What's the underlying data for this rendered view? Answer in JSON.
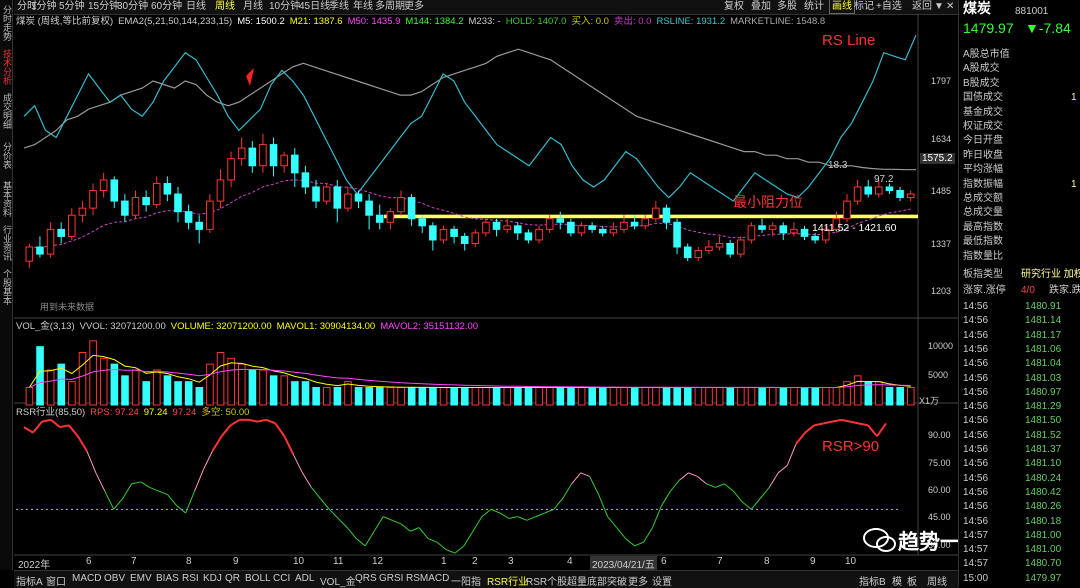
{
  "left_tabs": [
    "分时走势",
    "技术分析",
    "成交明细",
    "分价表",
    "基本资料",
    "行业资讯",
    "个股基本"
  ],
  "top_tabs": [
    "分时",
    "1分钟",
    "5分钟",
    "15分钟",
    "30分钟",
    "60分钟",
    "日线",
    "周线",
    "月线",
    "10分钟",
    "45日线",
    "季线",
    "年线",
    "多周期",
    "更多"
  ],
  "top_right": [
    "复权",
    "叠加",
    "多股",
    "统计",
    "画线",
    "标记",
    "+自选",
    "返回"
  ],
  "window_icons": [
    "▼",
    "✕"
  ],
  "legend_main": [
    {
      "text": "煤炭 (周线,等比前复权)",
      "color": "#cccccc"
    },
    {
      "text": "EMA2(5,21,50,144,233,15)",
      "color": "#cccccc"
    },
    {
      "text": "M5: 1500.2",
      "color": "#ffffff"
    },
    {
      "text": "M21: 1387.6",
      "color": "#ffff00"
    },
    {
      "text": "M50: 1435.9",
      "color": "#ff44ff"
    },
    {
      "text": "M144: 1384.2",
      "color": "#33ff33"
    },
    {
      "text": "M233: -",
      "color": "#cccccc"
    },
    {
      "text": "HOLD: 1407.0",
      "color": "#33cc33"
    },
    {
      "text": "买入: 0.0",
      "color": "#cccc00"
    },
    {
      "text": "卖出: 0.0",
      "color": "#cc33cc"
    },
    {
      "text": "RSLINE: 1931.2",
      "color": "#33cccc"
    },
    {
      "text": "MARKETLINE: 1548.8",
      "color": "#aaaaaa"
    }
  ],
  "legend_vol": [
    {
      "text": "VOL_金(3,13)",
      "color": "#cccccc"
    },
    {
      "text": "VVOL: 32071200.00",
      "color": "#cccccc"
    },
    {
      "text": "VOLUME: 32071200.00",
      "color": "#ffff00"
    },
    {
      "text": "MAVOL1: 30904134.00",
      "color": "#ffff00"
    },
    {
      "text": "MAVOL2: 35151132.00",
      "color": "#ff44ff"
    }
  ],
  "legend_rsr": [
    {
      "text": "RSR行业(85,50)",
      "color": "#cccccc"
    },
    {
      "text": "RPS: 97.24",
      "color": "#ff4444"
    },
    {
      "text": "97.24",
      "color": "#ffff00"
    },
    {
      "text": "97.24",
      "color": "#ff4444"
    },
    {
      "text": "多空: 50.00",
      "color": "#cccc00"
    }
  ],
  "annotations": {
    "rs_line": "RS Line",
    "resist": "最小阻力位",
    "resist_range": "1411.52 - 1421.60",
    "high_lbl": "18.3",
    "last_lbl": "97.2",
    "rsr90": "RSR>90",
    "no_data": "用到未来数据",
    "price_tag": "1575.2",
    "x1w": "X1万"
  },
  "y_main": [
    "1797",
    "1634",
    "1485",
    "1337",
    "1203"
  ],
  "y_vol": [
    "10000",
    "5000"
  ],
  "y_rsr": [
    "90.00",
    "75.00",
    "60.00",
    "45.00",
    "30.00"
  ],
  "x_labels": [
    "2022年",
    "6",
    "7",
    "8",
    "9",
    "10",
    "11",
    "12",
    "1",
    "2",
    "3",
    "4",
    "2023/04/21/五",
    "6",
    "7",
    "8",
    "9",
    "10"
  ],
  "bottom_tabs": [
    "指标A",
    "窗口",
    "MACD",
    "OBV",
    "EMV",
    "BIAS",
    "RSI",
    "KDJ",
    "QR",
    "BOLL",
    "CCI",
    "ADL",
    "VOL_金",
    "QRS",
    "GRSI",
    "RSMACD",
    "一阳指",
    "RSR行业",
    "RSR个股",
    "超量底部突破",
    "更多",
    "设置"
  ],
  "bottom_right": [
    "指标B",
    "模",
    "板",
    "周线"
  ],
  "quote": {
    "name": "煤炭",
    "code": "881001",
    "price": "1479.97",
    "change": "▼-7.84"
  },
  "quote_fields": [
    {
      "label": "A股总市值",
      "value": ""
    },
    {
      "label": "A股成交",
      "value": ""
    },
    {
      "label": "B股成交",
      "value": ""
    },
    {
      "label": "国债成交",
      "value": "1"
    },
    {
      "label": "基金成交",
      "value": ""
    },
    {
      "label": "权证成交",
      "value": ""
    },
    {
      "label": "今日开盘",
      "value": ""
    },
    {
      "label": "昨日收盘",
      "value": ""
    },
    {
      "label": "平均涨幅",
      "value": ""
    },
    {
      "label": "指数振幅",
      "value": "1"
    },
    {
      "label": "总成交额",
      "value": ""
    },
    {
      "label": "总成交量",
      "value": ""
    },
    {
      "label": "最高指数",
      "value": ""
    },
    {
      "label": "最低指数",
      "value": ""
    },
    {
      "label": "指数量比",
      "value": ""
    }
  ],
  "sector": {
    "label": "板指类型",
    "value": "研究行业 加权"
  },
  "adv": {
    "label": "涨家.涨停",
    "value": "4/0",
    "extra": "跌家.跌"
  },
  "ticks": [
    {
      "t": "14:56",
      "p": "1480.91"
    },
    {
      "t": "14:56",
      "p": "1481.14"
    },
    {
      "t": "14:56",
      "p": "1481.17"
    },
    {
      "t": "14:56",
      "p": "1481.06"
    },
    {
      "t": "14:56",
      "p": "1481.04"
    },
    {
      "t": "14:56",
      "p": "1481.03"
    },
    {
      "t": "14:56",
      "p": "1480.97"
    },
    {
      "t": "14:56",
      "p": "1481.29"
    },
    {
      "t": "14:56",
      "p": "1481.50"
    },
    {
      "t": "14:56",
      "p": "1481.52"
    },
    {
      "t": "14:56",
      "p": "1481.37"
    },
    {
      "t": "14:56",
      "p": "1481.10"
    },
    {
      "t": "14:56",
      "p": "1480.24"
    },
    {
      "t": "14:56",
      "p": "1480.42"
    },
    {
      "t": "14:56",
      "p": "1480.26"
    },
    {
      "t": "14:56",
      "p": "1480.18"
    },
    {
      "t": "14:57",
      "p": "1481.00"
    },
    {
      "t": "14:57",
      "p": "1481.00"
    },
    {
      "t": "14:57",
      "p": "1480.70"
    },
    {
      "t": "15:00",
      "p": "1479.97"
    }
  ],
  "watermark": "趋势一阳指",
  "colors": {
    "up": "#ff3333",
    "down": "#33ffff",
    "rsline": "#33bbcc",
    "market": "#999999",
    "resist": "#ffff66",
    "rsr_up": "#ff3333",
    "rsr_dn": "#33cc33",
    "rsr_mid": "#ff99cc"
  },
  "chart_data": [
    {
      "type": "candlestick",
      "title": "煤炭 (周线,等比前复权)",
      "ylim": [
        1180,
        1950
      ],
      "y_ticks": [
        1797,
        1634,
        1485,
        1337,
        1203
      ],
      "candles": [
        [
          1290,
          1330,
          1270,
          1340
        ],
        [
          1330,
          1310,
          1300,
          1360
        ],
        [
          1310,
          1380,
          1300,
          1400
        ],
        [
          1380,
          1360,
          1340,
          1400
        ],
        [
          1360,
          1420,
          1350,
          1440
        ],
        [
          1420,
          1440,
          1400,
          1460
        ],
        [
          1440,
          1490,
          1420,
          1510
        ],
        [
          1490,
          1520,
          1470,
          1540
        ],
        [
          1520,
          1460,
          1440,
          1530
        ],
        [
          1460,
          1420,
          1400,
          1480
        ],
        [
          1420,
          1470,
          1410,
          1490
        ],
        [
          1470,
          1450,
          1430,
          1490
        ],
        [
          1450,
          1510,
          1440,
          1530
        ],
        [
          1510,
          1480,
          1460,
          1530
        ],
        [
          1480,
          1430,
          1400,
          1500
        ],
        [
          1430,
          1400,
          1380,
          1450
        ],
        [
          1400,
          1380,
          1340,
          1420
        ],
        [
          1380,
          1460,
          1370,
          1480
        ],
        [
          1460,
          1520,
          1440,
          1550
        ],
        [
          1520,
          1580,
          1500,
          1600
        ],
        [
          1580,
          1610,
          1560,
          1640
        ],
        [
          1610,
          1560,
          1540,
          1630
        ],
        [
          1560,
          1620,
          1540,
          1650
        ],
        [
          1620,
          1560,
          1530,
          1640
        ],
        [
          1560,
          1590,
          1540,
          1600
        ],
        [
          1590,
          1540,
          1500,
          1610
        ],
        [
          1540,
          1500,
          1480,
          1560
        ],
        [
          1500,
          1460,
          1440,
          1520
        ],
        [
          1460,
          1500,
          1450,
          1510
        ],
        [
          1500,
          1440,
          1400,
          1520
        ],
        [
          1440,
          1480,
          1430,
          1500
        ],
        [
          1480,
          1460,
          1440,
          1490
        ],
        [
          1460,
          1420,
          1380,
          1480
        ],
        [
          1420,
          1400,
          1380,
          1450
        ],
        [
          1400,
          1430,
          1380,
          1440
        ],
        [
          1430,
          1470,
          1420,
          1490
        ],
        [
          1470,
          1410,
          1390,
          1480
        ],
        [
          1410,
          1390,
          1370,
          1420
        ],
        [
          1390,
          1350,
          1320,
          1400
        ],
        [
          1350,
          1380,
          1340,
          1390
        ],
        [
          1380,
          1360,
          1340,
          1390
        ],
        [
          1360,
          1340,
          1320,
          1370
        ],
        [
          1340,
          1370,
          1330,
          1380
        ],
        [
          1370,
          1400,
          1360,
          1410
        ],
        [
          1400,
          1380,
          1360,
          1410
        ],
        [
          1380,
          1390,
          1370,
          1410
        ],
        [
          1390,
          1370,
          1350,
          1400
        ],
        [
          1370,
          1350,
          1340,
          1380
        ],
        [
          1350,
          1380,
          1340,
          1390
        ],
        [
          1380,
          1410,
          1370,
          1420
        ],
        [
          1410,
          1400,
          1380,
          1430
        ],
        [
          1400,
          1370,
          1360,
          1410
        ],
        [
          1370,
          1390,
          1360,
          1400
        ],
        [
          1390,
          1380,
          1370,
          1400
        ],
        [
          1380,
          1370,
          1360,
          1390
        ],
        [
          1370,
          1380,
          1360,
          1400
        ],
        [
          1380,
          1400,
          1370,
          1420
        ],
        [
          1400,
          1390,
          1380,
          1420
        ],
        [
          1390,
          1410,
          1380,
          1420
        ],
        [
          1410,
          1440,
          1400,
          1460
        ],
        [
          1440,
          1400,
          1380,
          1450
        ],
        [
          1400,
          1330,
          1310,
          1410
        ],
        [
          1330,
          1300,
          1290,
          1340
        ],
        [
          1300,
          1320,
          1290,
          1330
        ],
        [
          1320,
          1330,
          1310,
          1350
        ],
        [
          1330,
          1340,
          1320,
          1360
        ],
        [
          1340,
          1310,
          1300,
          1350
        ],
        [
          1310,
          1350,
          1300,
          1360
        ],
        [
          1350,
          1390,
          1340,
          1400
        ],
        [
          1390,
          1380,
          1370,
          1410
        ],
        [
          1380,
          1390,
          1360,
          1400
        ],
        [
          1390,
          1370,
          1350,
          1400
        ],
        [
          1370,
          1380,
          1360,
          1400
        ],
        [
          1380,
          1360,
          1350,
          1390
        ],
        [
          1360,
          1350,
          1340,
          1370
        ],
        [
          1350,
          1380,
          1340,
          1390
        ],
        [
          1380,
          1410,
          1370,
          1430
        ],
        [
          1410,
          1460,
          1400,
          1480
        ],
        [
          1460,
          1500,
          1450,
          1520
        ],
        [
          1500,
          1480,
          1470,
          1520
        ],
        [
          1480,
          1500,
          1470,
          1520
        ],
        [
          1500,
          1490,
          1480,
          1510
        ],
        [
          1490,
          1470,
          1460,
          1500
        ],
        [
          1470,
          1480,
          1460,
          1490
        ]
      ],
      "series": [
        {
          "name": "RSLINE",
          "values": [
            1700,
            1730,
            1660,
            1640,
            1700,
            1760,
            1820,
            1780,
            1740,
            1760,
            1720,
            1700,
            1740,
            1800,
            1840,
            1880,
            1860,
            1810,
            1760,
            1700,
            1660,
            1690,
            1720,
            1790,
            1830,
            1800,
            1760,
            1700,
            1640,
            1580,
            1520,
            1480,
            1520,
            1560,
            1600,
            1640,
            1680,
            1700,
            1760,
            1820,
            1800,
            1740,
            1700,
            1660,
            1620,
            1600,
            1580,
            1560,
            1600,
            1640,
            1620,
            1560,
            1520,
            1500,
            1520,
            1560,
            1600,
            1580,
            1540,
            1500,
            1470,
            1500,
            1540,
            1520,
            1500,
            1480,
            1460,
            1500,
            1540,
            1520,
            1500,
            1480,
            1470,
            1500,
            1540,
            1580,
            1640,
            1680,
            1740,
            1800,
            1880,
            1870,
            1860,
            1930
          ]
        },
        {
          "name": "MARKETLINE",
          "values": [
            1610,
            1620,
            1640,
            1660,
            1690,
            1700,
            1720,
            1730,
            1740,
            1760,
            1770,
            1780,
            1800,
            1790,
            1780,
            1800,
            1790,
            1760,
            1740,
            1730,
            1740,
            1760,
            1780,
            1800,
            1820,
            1840,
            1850,
            1840,
            1830,
            1820,
            1810,
            1800,
            1790,
            1780,
            1770,
            1760,
            1760,
            1770,
            1790,
            1810,
            1820,
            1830,
            1840,
            1850,
            1870,
            1880,
            1890,
            1880,
            1870,
            1860,
            1840,
            1820,
            1800,
            1780,
            1760,
            1740,
            1720,
            1700,
            1690,
            1680,
            1670,
            1660,
            1650,
            1640,
            1630,
            1620,
            1610,
            1600,
            1600,
            1590,
            1590,
            1580,
            1580,
            1570,
            1570,
            1560,
            1560,
            1560,
            1555,
            1552,
            1550,
            1550,
            1549,
            1548.8
          ]
        }
      ],
      "resist_level": [
        1411.52,
        1421.6
      ]
    },
    {
      "type": "bar",
      "title": "VOL_金(3,13)",
      "y_ticks": [
        10000,
        5000
      ],
      "unit": "X1万",
      "values": [
        3,
        10,
        6,
        7,
        4,
        9,
        11,
        8,
        7,
        5,
        6,
        4,
        6,
        5,
        4,
        4,
        3,
        7,
        9,
        8,
        7,
        6,
        6,
        5,
        5,
        4,
        4,
        3,
        3,
        3,
        4,
        3,
        3,
        3,
        3,
        3,
        3,
        3,
        3,
        3,
        3,
        3,
        3,
        3,
        3,
        3,
        3,
        3,
        3,
        3,
        3,
        3,
        3,
        3,
        3,
        3,
        3,
        3,
        3,
        3,
        3,
        3,
        3,
        3,
        3,
        3,
        3,
        3,
        3,
        3,
        3,
        3,
        3,
        3,
        3,
        3,
        3,
        4,
        5,
        4,
        4,
        3,
        3,
        3
      ]
    },
    {
      "type": "line",
      "title": "RSR行业(85,50)",
      "ylim": [
        25,
        100
      ],
      "y_ticks": [
        90,
        75,
        60,
        45,
        30
      ],
      "threshold": 50,
      "values": [
        95,
        92,
        98,
        99,
        95,
        96,
        90,
        82,
        70,
        60,
        50,
        56,
        64,
        65,
        62,
        60,
        58,
        52,
        48,
        60,
        72,
        82,
        90,
        96,
        99,
        99,
        98,
        99,
        97,
        90,
        80,
        70,
        62,
        56,
        50,
        45,
        40,
        34,
        30,
        38,
        46,
        44,
        42,
        38,
        40,
        34,
        32,
        28,
        26,
        30,
        38,
        46,
        50,
        48,
        45,
        46,
        44,
        46,
        48,
        50,
        56,
        64,
        70,
        68,
        58,
        46,
        40,
        34,
        30,
        32,
        40,
        52,
        60,
        66,
        70,
        68,
        64,
        62,
        64,
        60,
        54,
        50,
        56,
        62,
        70,
        74,
        86,
        92,
        96,
        97,
        98,
        99,
        98,
        97,
        96,
        90,
        97
      ]
    }
  ]
}
